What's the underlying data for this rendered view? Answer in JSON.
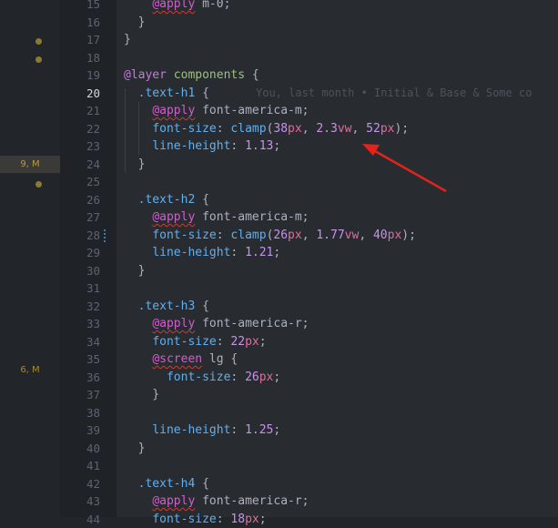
{
  "change_markers": [
    {
      "label": "9, M",
      "highlight": true
    },
    {
      "label": "6, M",
      "highlight": false
    }
  ],
  "active_line": 20,
  "blame": "You, last month • Initial & Base & Some co",
  "lines": [
    {
      "n": "15",
      "parts": [
        [
          "    ",
          "p"
        ],
        [
          "@apply",
          "at"
        ],
        [
          " m-0;",
          "p"
        ]
      ]
    },
    {
      "n": "16",
      "parts": [
        [
          "  }",
          "p"
        ]
      ]
    },
    {
      "n": "17",
      "parts": [
        [
          "}",
          "p"
        ]
      ]
    },
    {
      "n": "18",
      "parts": []
    },
    {
      "n": "19",
      "parts": [
        [
          "@layer",
          "kw"
        ],
        [
          " ",
          "p"
        ],
        [
          "components",
          "cls"
        ],
        [
          " ",
          "p"
        ],
        [
          "{",
          "p"
        ]
      ]
    },
    {
      "n": "20",
      "parts": [
        [
          "  ",
          "p"
        ],
        [
          ".text-h1",
          "sel"
        ],
        [
          " {",
          "p"
        ]
      ]
    },
    {
      "n": "21",
      "parts": [
        [
          "    ",
          "p"
        ],
        [
          "@apply",
          "at"
        ],
        [
          " font-america-m;",
          "p"
        ]
      ]
    },
    {
      "n": "22",
      "parts": [
        [
          "    ",
          "p"
        ],
        [
          "font-size",
          "prop"
        ],
        [
          ": ",
          "p"
        ],
        [
          "clamp",
          "fn"
        ],
        [
          "(",
          "p"
        ],
        [
          "38",
          "num-v"
        ],
        [
          "px",
          "unit"
        ],
        [
          ", ",
          "p"
        ],
        [
          "2.3",
          "num-v"
        ],
        [
          "vw",
          "unit"
        ],
        [
          ", ",
          "p"
        ],
        [
          "52",
          "num-v"
        ],
        [
          "px",
          "unit"
        ],
        [
          ");",
          "p"
        ]
      ]
    },
    {
      "n": "23",
      "parts": [
        [
          "    ",
          "p"
        ],
        [
          "line-height",
          "prop"
        ],
        [
          ": ",
          "p"
        ],
        [
          "1.13",
          "num-v"
        ],
        [
          ";",
          "p"
        ]
      ]
    },
    {
      "n": "24",
      "parts": [
        [
          "  }",
          "p"
        ]
      ]
    },
    {
      "n": "25",
      "parts": []
    },
    {
      "n": "26",
      "parts": [
        [
          "  ",
          "p"
        ],
        [
          ".text-h2",
          "sel"
        ],
        [
          " {",
          "p"
        ]
      ]
    },
    {
      "n": "27",
      "parts": [
        [
          "    ",
          "p"
        ],
        [
          "@apply",
          "at"
        ],
        [
          " font-america-m;",
          "p"
        ]
      ]
    },
    {
      "n": "28",
      "parts": [
        [
          "    ",
          "p"
        ],
        [
          "font-size",
          "prop"
        ],
        [
          ": ",
          "p"
        ],
        [
          "clamp",
          "fn"
        ],
        [
          "(",
          "p"
        ],
        [
          "26",
          "num-v"
        ],
        [
          "px",
          "unit"
        ],
        [
          ", ",
          "p"
        ],
        [
          "1.77",
          "num-v"
        ],
        [
          "vw",
          "unit"
        ],
        [
          ", ",
          "p"
        ],
        [
          "40",
          "num-v"
        ],
        [
          "px",
          "unit"
        ],
        [
          ");",
          "p"
        ]
      ]
    },
    {
      "n": "29",
      "parts": [
        [
          "    ",
          "p"
        ],
        [
          "line-height",
          "prop"
        ],
        [
          ": ",
          "p"
        ],
        [
          "1.21",
          "num-v"
        ],
        [
          ";",
          "p"
        ]
      ]
    },
    {
      "n": "30",
      "parts": [
        [
          "  }",
          "p"
        ]
      ]
    },
    {
      "n": "31",
      "parts": []
    },
    {
      "n": "32",
      "parts": [
        [
          "  ",
          "p"
        ],
        [
          ".text-h3",
          "sel"
        ],
        [
          " {",
          "p"
        ]
      ]
    },
    {
      "n": "33",
      "parts": [
        [
          "    ",
          "p"
        ],
        [
          "@apply",
          "at"
        ],
        [
          " font-america-r;",
          "p"
        ]
      ]
    },
    {
      "n": "34",
      "parts": [
        [
          "    ",
          "p"
        ],
        [
          "font-size",
          "prop"
        ],
        [
          ": ",
          "p"
        ],
        [
          "22",
          "num-v"
        ],
        [
          "px",
          "unit"
        ],
        [
          ";",
          "p"
        ]
      ]
    },
    {
      "n": "35",
      "parts": [
        [
          "    ",
          "p"
        ],
        [
          "@screen",
          "at"
        ],
        [
          " lg {",
          "p"
        ]
      ]
    },
    {
      "n": "36",
      "parts": [
        [
          "      ",
          "p"
        ],
        [
          "font-size",
          "prop"
        ],
        [
          ": ",
          "p"
        ],
        [
          "26",
          "num-v"
        ],
        [
          "px",
          "unit"
        ],
        [
          ";",
          "p"
        ]
      ]
    },
    {
      "n": "37",
      "parts": [
        [
          "    }",
          "p"
        ]
      ]
    },
    {
      "n": "38",
      "parts": []
    },
    {
      "n": "39",
      "parts": [
        [
          "    ",
          "p"
        ],
        [
          "line-height",
          "prop"
        ],
        [
          ": ",
          "p"
        ],
        [
          "1.25",
          "num-v"
        ],
        [
          ";",
          "p"
        ]
      ]
    },
    {
      "n": "40",
      "parts": [
        [
          "  }",
          "p"
        ]
      ]
    },
    {
      "n": "41",
      "parts": []
    },
    {
      "n": "42",
      "parts": [
        [
          "  ",
          "p"
        ],
        [
          ".text-h4",
          "sel"
        ],
        [
          " {",
          "p"
        ]
      ]
    },
    {
      "n": "43",
      "parts": [
        [
          "    ",
          "p"
        ],
        [
          "@apply",
          "at"
        ],
        [
          " font-america-r;",
          "p"
        ]
      ]
    },
    {
      "n": "44",
      "parts": [
        [
          "    ",
          "p"
        ],
        [
          "font-size",
          "prop"
        ],
        [
          ": ",
          "p"
        ],
        [
          "18",
          "num-v"
        ],
        [
          "px",
          "unit"
        ],
        [
          ";",
          "p"
        ]
      ]
    }
  ]
}
